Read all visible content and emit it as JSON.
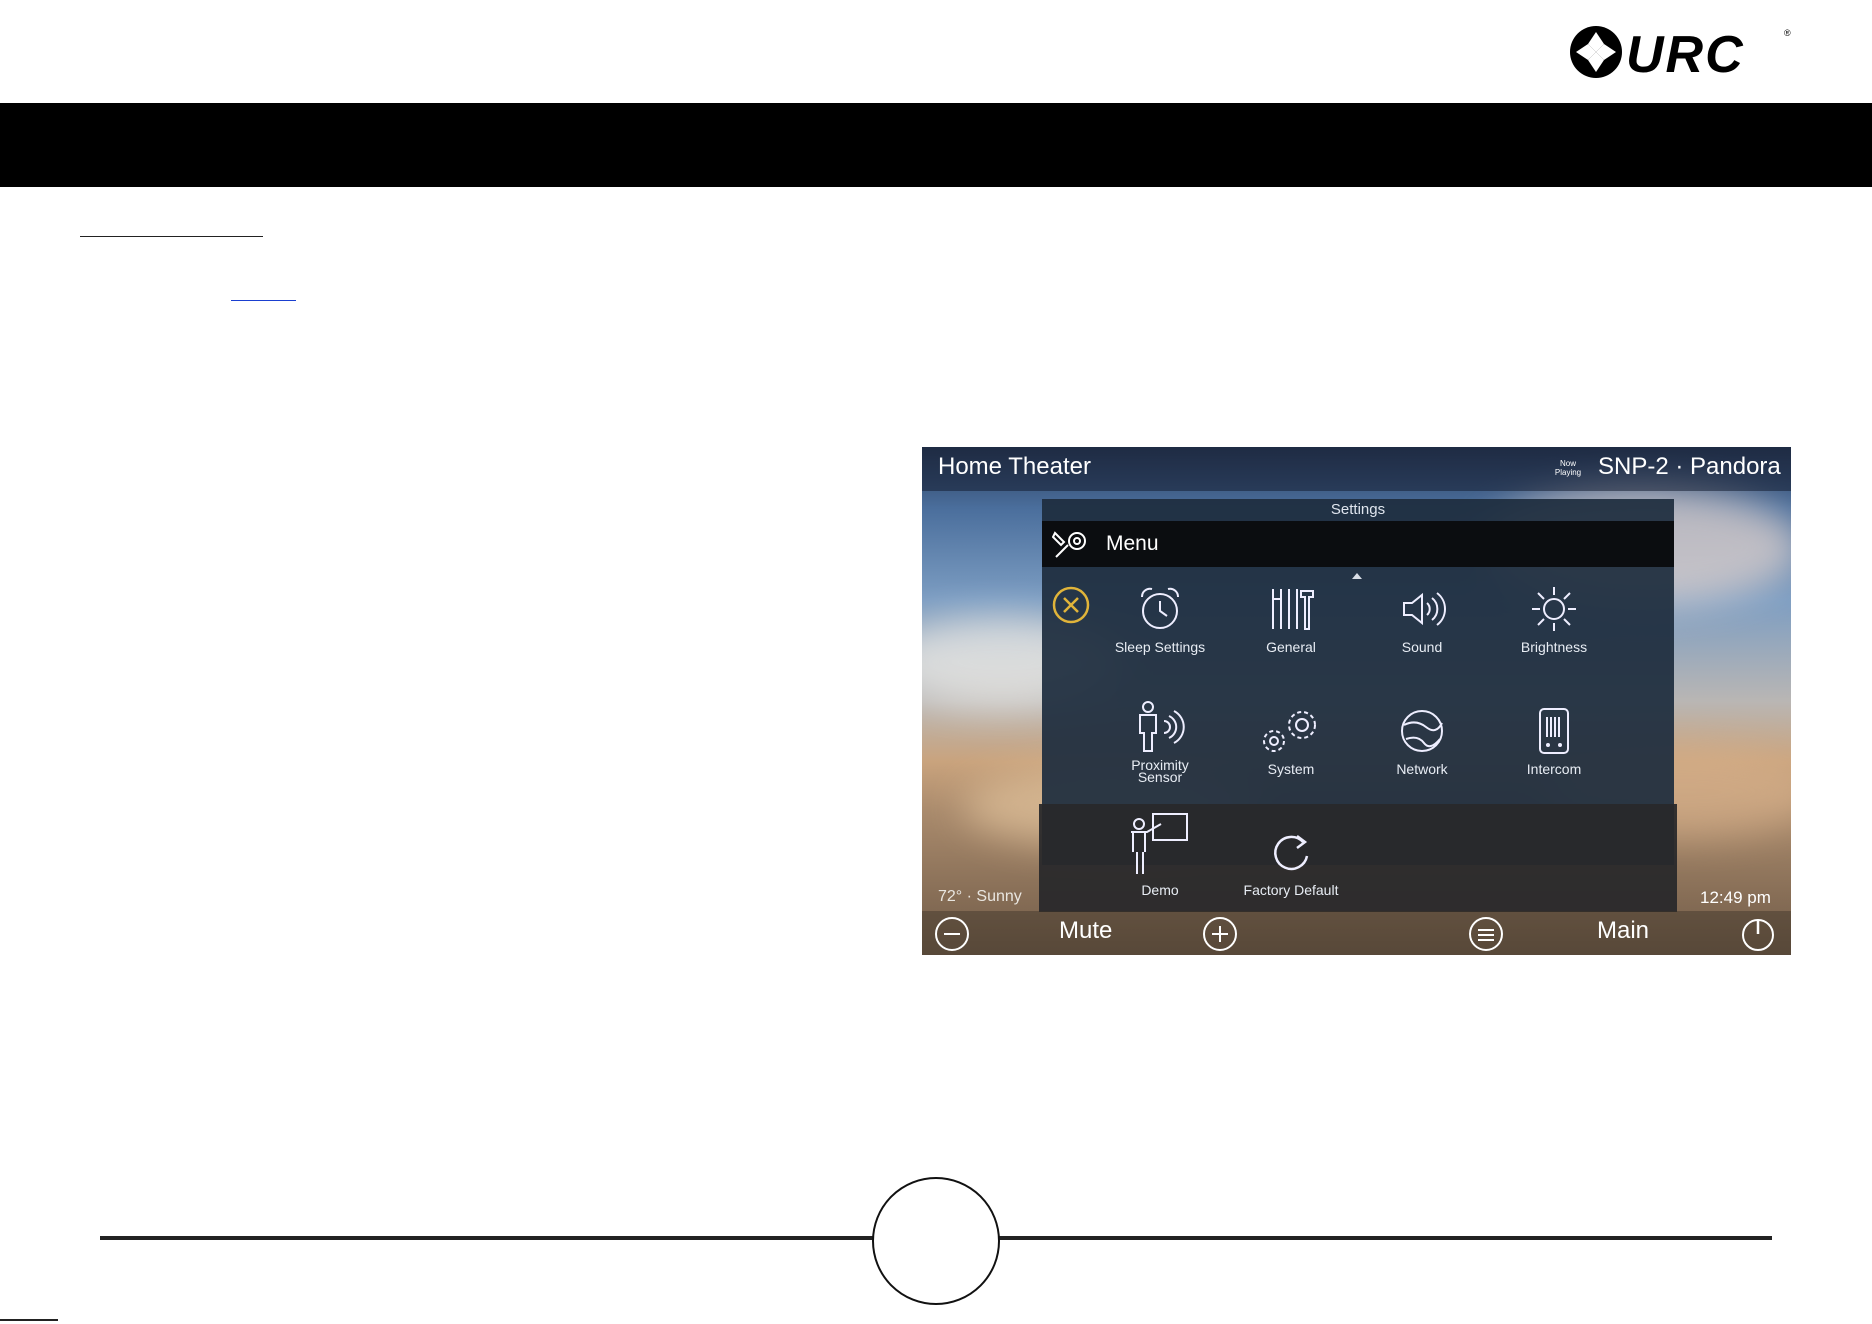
{
  "brand": {
    "logo_text": "URC"
  },
  "screenshot": {
    "room": "Home Theater",
    "now_playing_line1": "Now",
    "now_playing_line2": "Playing",
    "source": "SNP-2 · Pandora",
    "panel_title": "Settings",
    "menu_label": "Menu",
    "tiles": [
      {
        "label": "Sleep Settings",
        "icon": "alarm-clock-icon"
      },
      {
        "label": "General",
        "icon": "tools-icon"
      },
      {
        "label": "Sound",
        "icon": "speaker-icon"
      },
      {
        "label": "Brightness",
        "icon": "sun-icon"
      },
      {
        "label_line1": "Proximity",
        "label_line2": "Sensor",
        "icon": "proximity-sensor-icon"
      },
      {
        "label": "System",
        "icon": "gears-icon"
      },
      {
        "label": "Network",
        "icon": "globe-icon"
      },
      {
        "label": "Intercom",
        "icon": "intercom-icon"
      },
      {
        "label": "Demo",
        "icon": "presenter-icon"
      },
      {
        "label": "Factory Default",
        "icon": "reset-icon"
      }
    ],
    "weather": "72° · Sunny",
    "time": "12:49 pm",
    "bottom": {
      "mute": "Mute",
      "main": "Main"
    }
  }
}
